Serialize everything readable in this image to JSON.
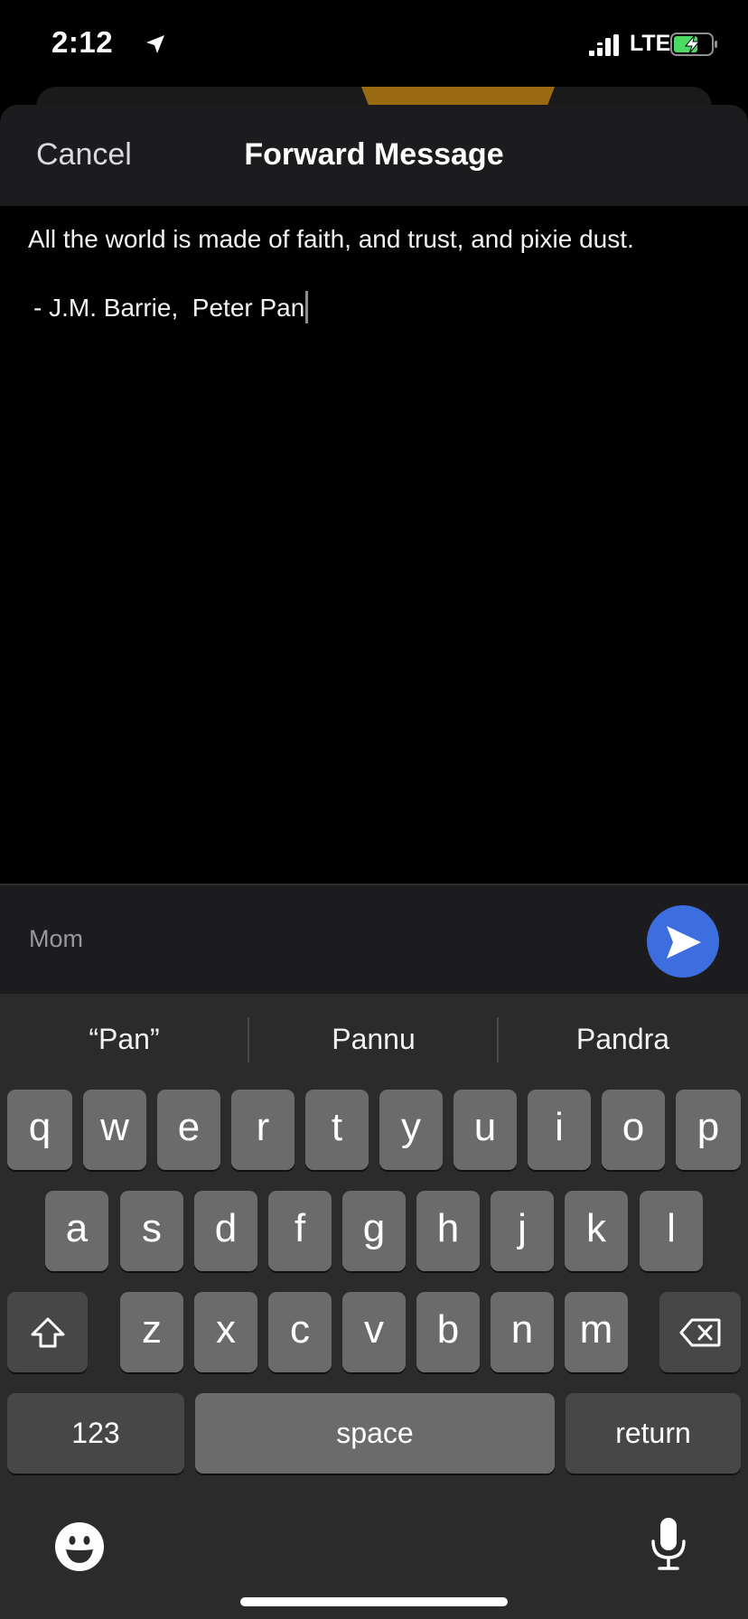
{
  "status_bar": {
    "time": "2:12",
    "network": "LTE",
    "battery_color": "#4cd964"
  },
  "header": {
    "cancel_label": "Cancel",
    "title": "Forward Message"
  },
  "message": {
    "line1": "All the world is made of faith, and trust, and pixie dust.",
    "line2": "- J.M. Barrie,  Peter Pan"
  },
  "recipient": {
    "name": "Mom",
    "send_color": "#3d6ee0"
  },
  "keyboard": {
    "suggestions": [
      "“Pan”",
      "Pannu",
      "Pandra"
    ],
    "row1": [
      "q",
      "w",
      "e",
      "r",
      "t",
      "y",
      "u",
      "i",
      "o",
      "p"
    ],
    "row2": [
      "a",
      "s",
      "d",
      "f",
      "g",
      "h",
      "j",
      "k",
      "l"
    ],
    "row3": [
      "z",
      "x",
      "c",
      "v",
      "b",
      "n",
      "m"
    ],
    "numbers_label": "123",
    "space_label": "space",
    "return_label": "return"
  }
}
